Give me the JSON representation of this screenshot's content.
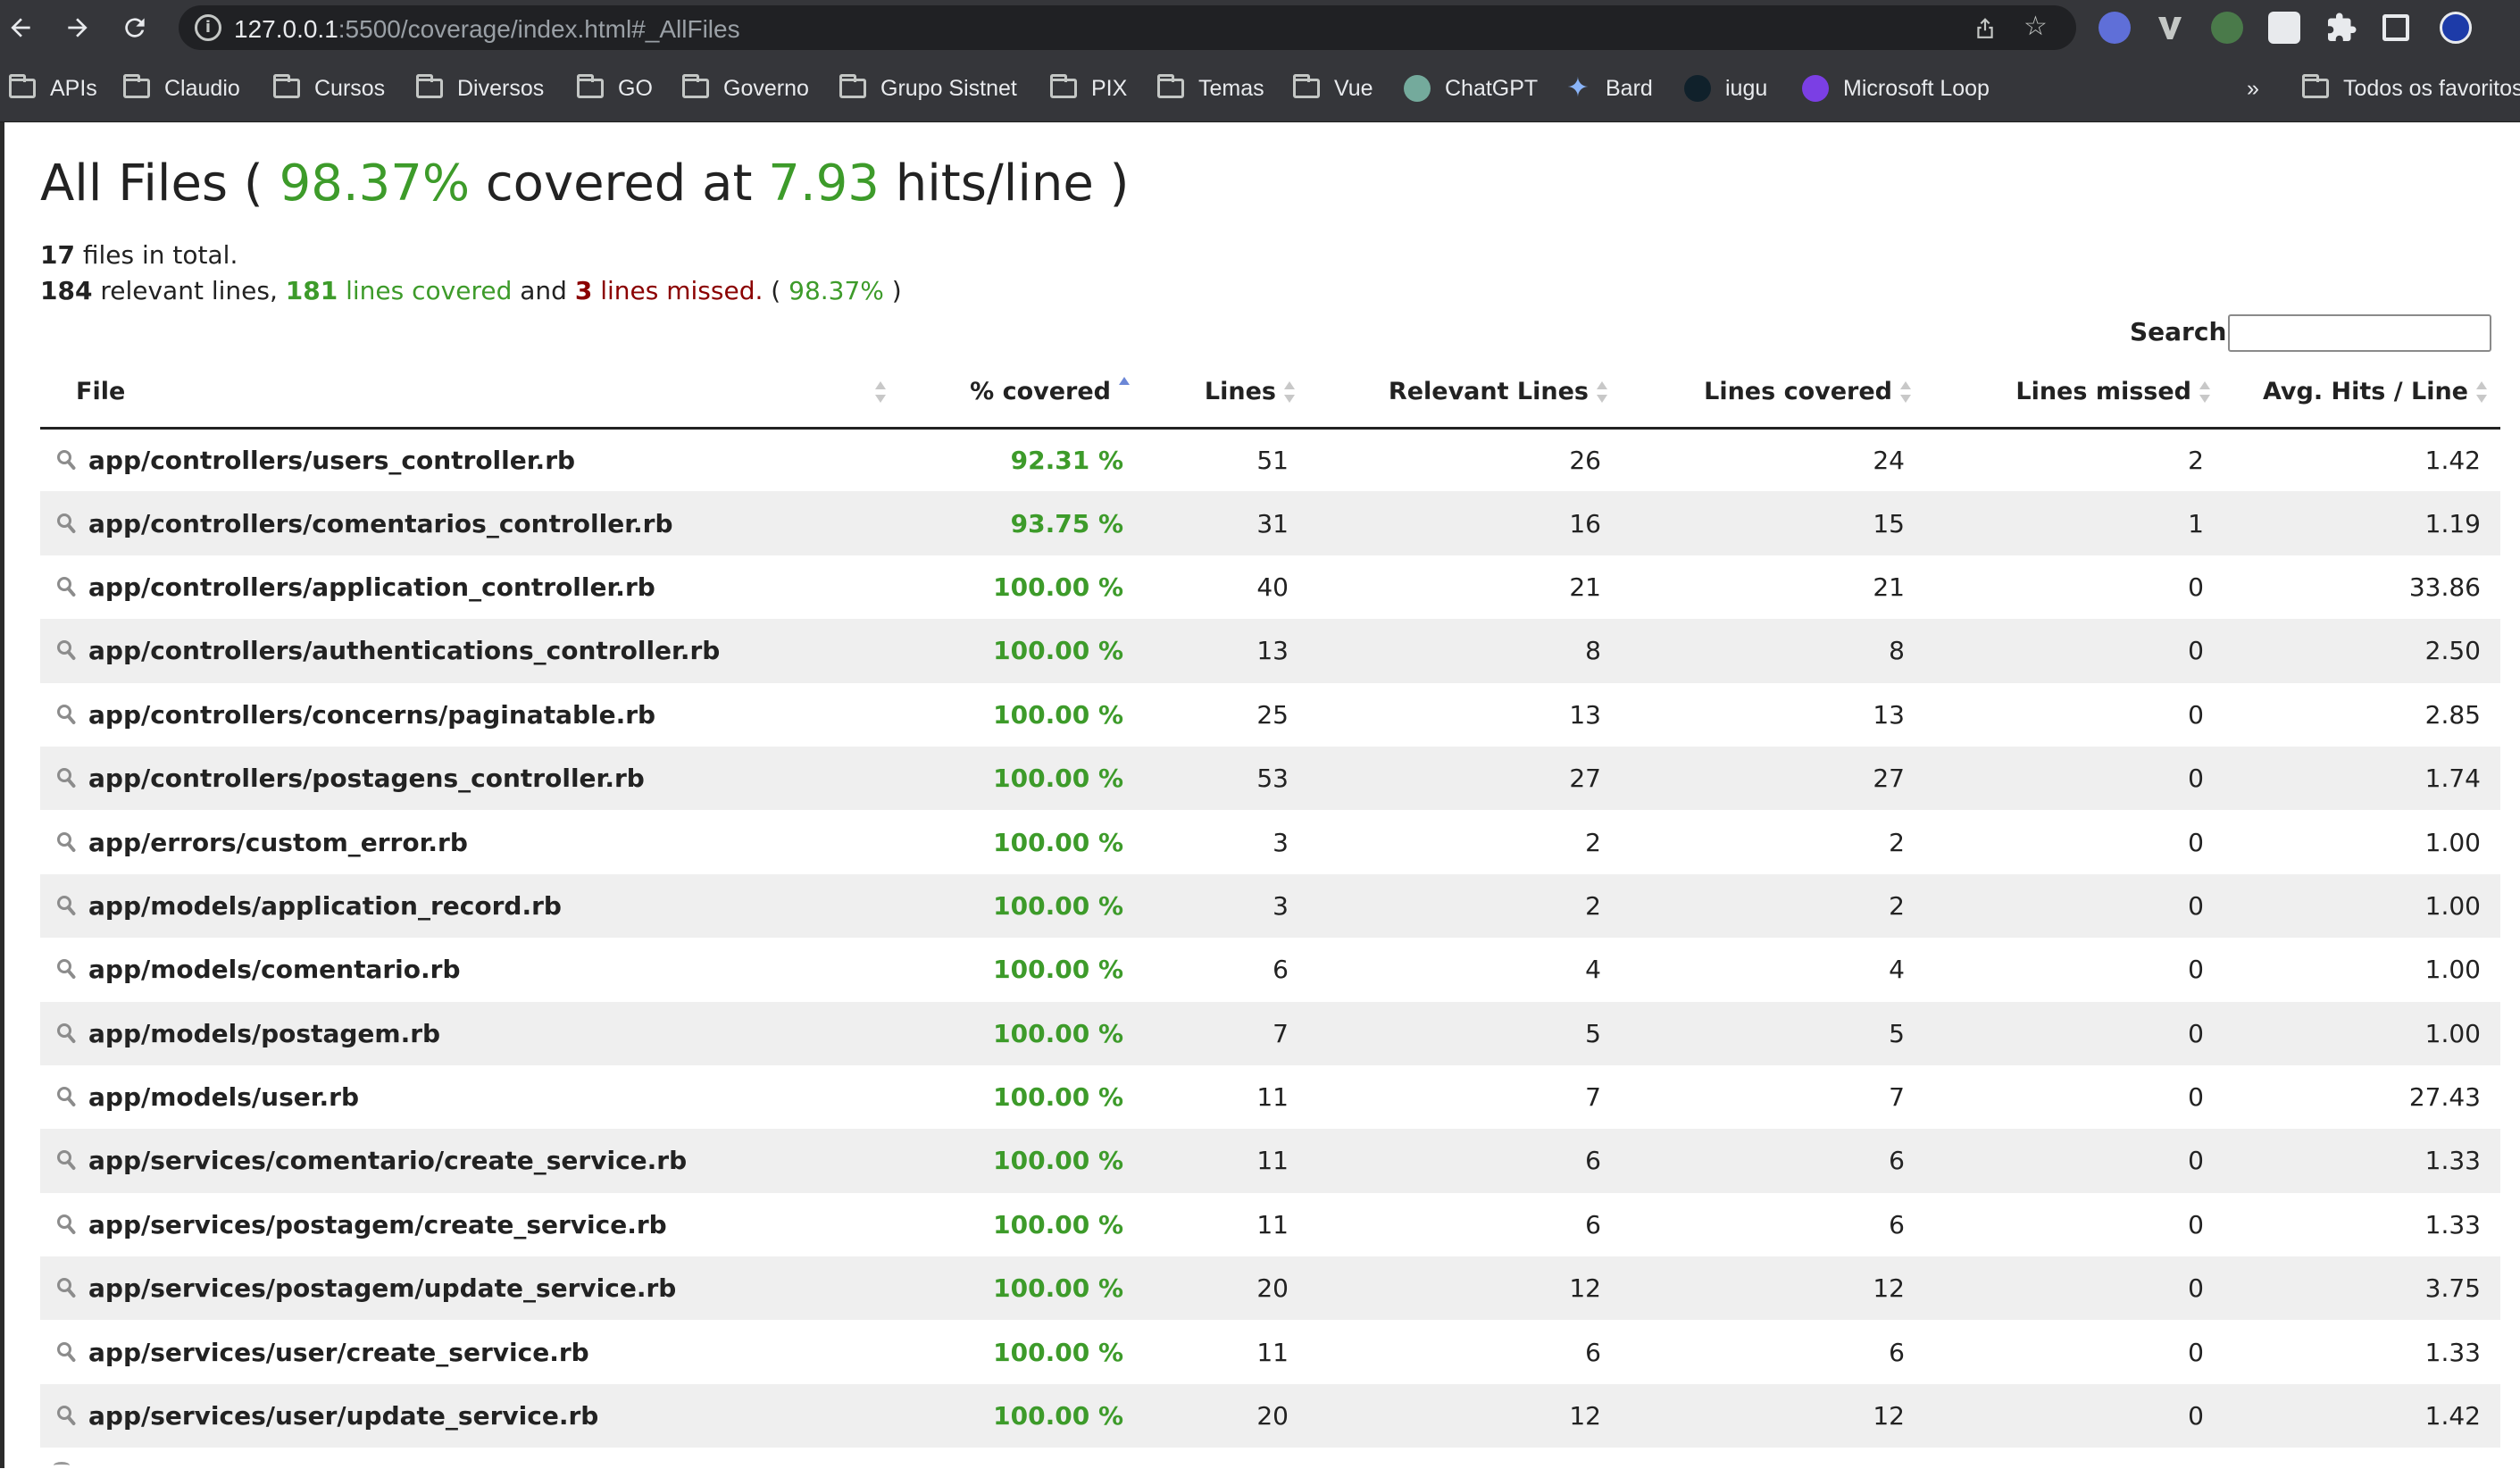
{
  "browser": {
    "url_host": "127.0.0.1",
    "url_rest": ":5500/coverage/index.html#_AllFiles",
    "bookmarks": [
      "APIs",
      "Claudio",
      "Cursos",
      "Diversos",
      "GO",
      "Governo",
      "Grupo Sistnet",
      "PIX",
      "Temas",
      "Vue",
      "ChatGPT",
      "Bard",
      "iugu",
      "Microsoft Loop"
    ],
    "bookmarks_more": "»",
    "all_bookmarks": "Todos os favoritos"
  },
  "heading": {
    "prefix": "All Files ( ",
    "percent": "98.37%",
    "middle": " covered at ",
    "hits": "7.93",
    "suffix": " hits/line )"
  },
  "summary": {
    "files_count": "17",
    "files_text": " files in total.",
    "relevant_count": "184",
    "relevant_text": " relevant lines, ",
    "covered_count": "181",
    "covered_text": " lines covered",
    "and_text": " and ",
    "missed_count": "3",
    "missed_text": " lines missed.",
    "percent_text": " ( ",
    "percent": "98.37%",
    "close": " )"
  },
  "search": {
    "label": "Search:",
    "value": ""
  },
  "table": {
    "columns": [
      "File",
      "% covered",
      "Lines",
      "Relevant Lines",
      "Lines covered",
      "Lines missed",
      "Avg. Hits / Line"
    ],
    "rows": [
      {
        "file": "app/controllers/users_controller.rb",
        "covered": "92.31 %",
        "lines": "51",
        "relevant": "26",
        "lines_covered": "24",
        "missed": "2",
        "avg": "1.42"
      },
      {
        "file": "app/controllers/comentarios_controller.rb",
        "covered": "93.75 %",
        "lines": "31",
        "relevant": "16",
        "lines_covered": "15",
        "missed": "1",
        "avg": "1.19"
      },
      {
        "file": "app/controllers/application_controller.rb",
        "covered": "100.00 %",
        "lines": "40",
        "relevant": "21",
        "lines_covered": "21",
        "missed": "0",
        "avg": "33.86"
      },
      {
        "file": "app/controllers/authentications_controller.rb",
        "covered": "100.00 %",
        "lines": "13",
        "relevant": "8",
        "lines_covered": "8",
        "missed": "0",
        "avg": "2.50"
      },
      {
        "file": "app/controllers/concerns/paginatable.rb",
        "covered": "100.00 %",
        "lines": "25",
        "relevant": "13",
        "lines_covered": "13",
        "missed": "0",
        "avg": "2.85"
      },
      {
        "file": "app/controllers/postagens_controller.rb",
        "covered": "100.00 %",
        "lines": "53",
        "relevant": "27",
        "lines_covered": "27",
        "missed": "0",
        "avg": "1.74"
      },
      {
        "file": "app/errors/custom_error.rb",
        "covered": "100.00 %",
        "lines": "3",
        "relevant": "2",
        "lines_covered": "2",
        "missed": "0",
        "avg": "1.00"
      },
      {
        "file": "app/models/application_record.rb",
        "covered": "100.00 %",
        "lines": "3",
        "relevant": "2",
        "lines_covered": "2",
        "missed": "0",
        "avg": "1.00"
      },
      {
        "file": "app/models/comentario.rb",
        "covered": "100.00 %",
        "lines": "6",
        "relevant": "4",
        "lines_covered": "4",
        "missed": "0",
        "avg": "1.00"
      },
      {
        "file": "app/models/postagem.rb",
        "covered": "100.00 %",
        "lines": "7",
        "relevant": "5",
        "lines_covered": "5",
        "missed": "0",
        "avg": "1.00"
      },
      {
        "file": "app/models/user.rb",
        "covered": "100.00 %",
        "lines": "11",
        "relevant": "7",
        "lines_covered": "7",
        "missed": "0",
        "avg": "27.43"
      },
      {
        "file": "app/services/comentario/create_service.rb",
        "covered": "100.00 %",
        "lines": "11",
        "relevant": "6",
        "lines_covered": "6",
        "missed": "0",
        "avg": "1.33"
      },
      {
        "file": "app/services/postagem/create_service.rb",
        "covered": "100.00 %",
        "lines": "11",
        "relevant": "6",
        "lines_covered": "6",
        "missed": "0",
        "avg": "1.33"
      },
      {
        "file": "app/services/postagem/update_service.rb",
        "covered": "100.00 %",
        "lines": "20",
        "relevant": "12",
        "lines_covered": "12",
        "missed": "0",
        "avg": "3.75"
      },
      {
        "file": "app/services/user/create_service.rb",
        "covered": "100.00 %",
        "lines": "11",
        "relevant": "6",
        "lines_covered": "6",
        "missed": "0",
        "avg": "1.33"
      },
      {
        "file": "app/services/user/update_service.rb",
        "covered": "100.00 %",
        "lines": "20",
        "relevant": "12",
        "lines_covered": "12",
        "missed": "0",
        "avg": "1.42"
      }
    ]
  }
}
